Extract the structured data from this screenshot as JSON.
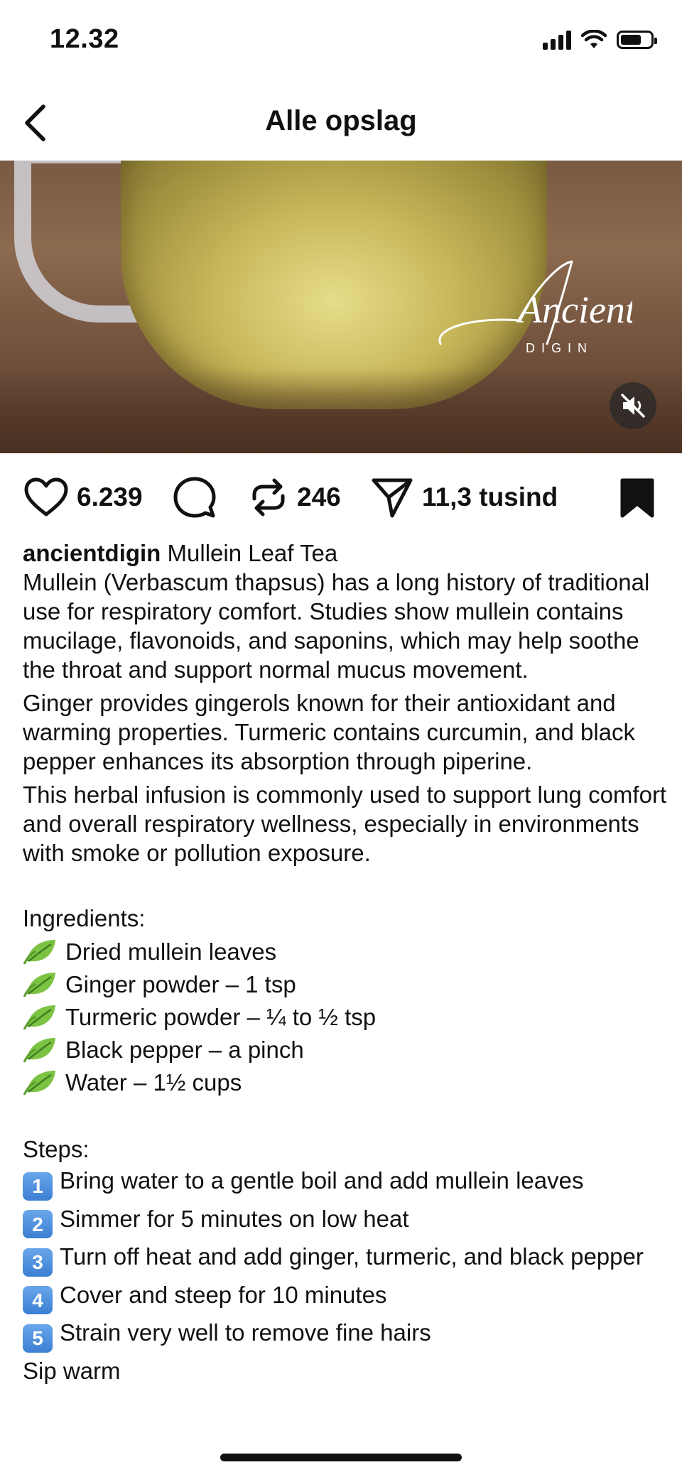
{
  "status_bar": {
    "time": "12.32",
    "battery_level": 0.6
  },
  "header": {
    "title": "Alle opslag",
    "back_icon": "chevron-left-icon"
  },
  "video": {
    "logo_text": "Ancient",
    "logo_subtext": "DIGIN",
    "mute_icon": "speaker-muted-icon"
  },
  "actions": {
    "likes": "6.239",
    "reposts": "246",
    "shares": "11,3 tusind",
    "icons": [
      "heart-icon",
      "comment-icon",
      "repost-icon",
      "send-icon",
      "bookmark-icon"
    ]
  },
  "caption": {
    "username": "ancientdigin",
    "title": "Mullein Leaf Tea",
    "paragraphs": [
      "Mullein (Verbascum thapsus) has a long history of traditional use for respiratory comfort. Studies show mullein contains mucilage, flavonoids, and saponins, which may help soothe the throat and support normal mucus movement.",
      "Ginger provides gingerols known for their antioxidant and warming properties. Turmeric contains curcumin, and black pepper enhances its absorption through piperine.",
      "This herbal infusion is commonly used to support lung comfort and overall respiratory wellness, especially in environments with smoke or pollution exposure."
    ],
    "ingredients_heading": "Ingredients:",
    "ingredients": [
      "Dried mullein leaves",
      "Ginger powder – 1 tsp",
      "Turmeric powder – ¼ to ½ tsp",
      "Black pepper – a pinch",
      "Water – 1½ cups"
    ],
    "steps_heading": "Steps:",
    "steps": [
      {
        "num": "1",
        "text": "Bring water to a gentle boil and add mullein leaves"
      },
      {
        "num": "2",
        "text": "Simmer for 5 minutes on low heat"
      },
      {
        "num": "3",
        "text": "Turn off heat and add ginger, turmeric, and black pepper"
      },
      {
        "num": "4",
        "text": "Cover and steep for 10 minutes"
      },
      {
        "num": "5",
        "text": "Strain very well to remove fine hairs"
      }
    ],
    "closing": "Sip warm"
  }
}
